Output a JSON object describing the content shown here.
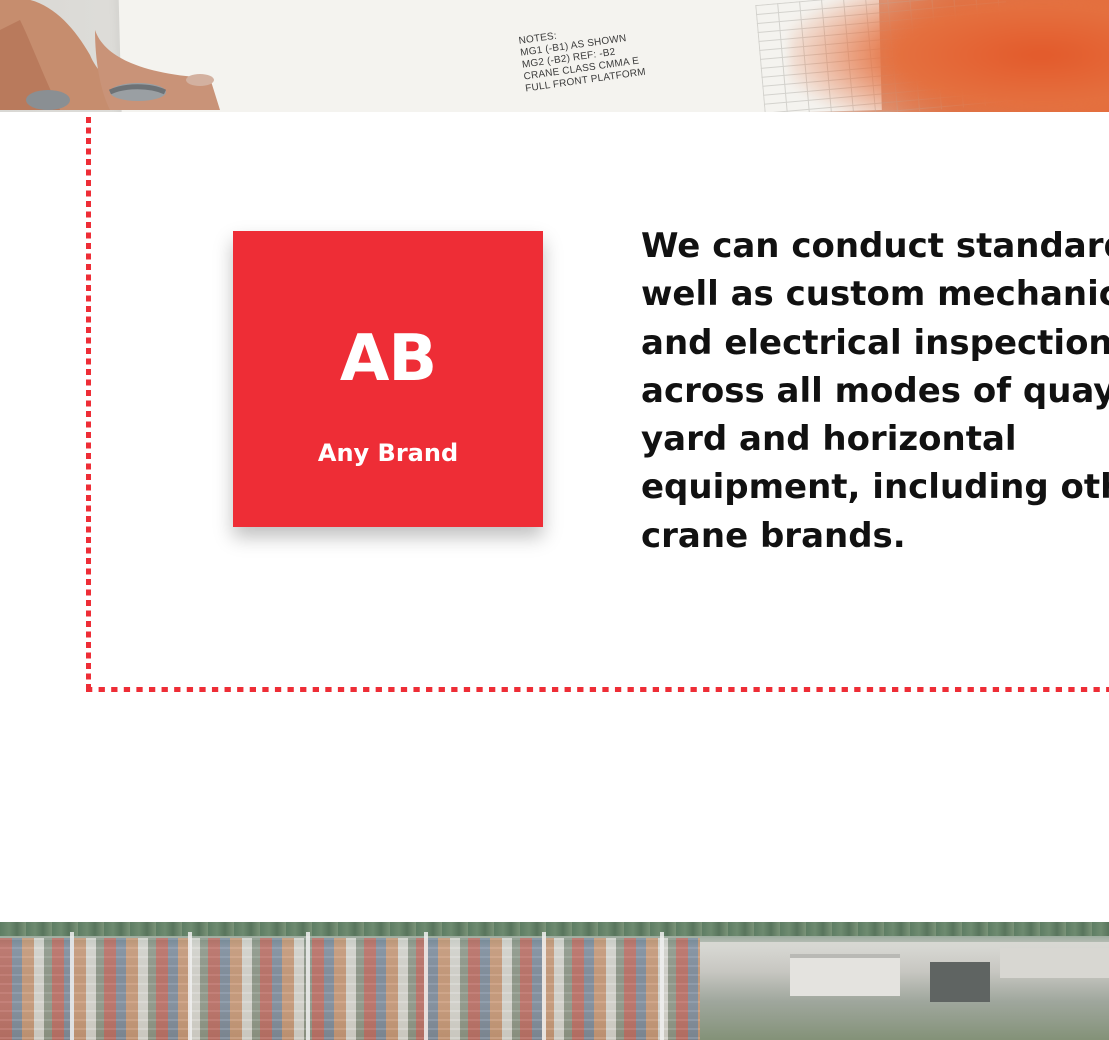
{
  "hero_image": {
    "notes_lines": [
      "NOTES:",
      "MG1 (-B1) AS SHOWN",
      "MG2 (-B2) REF: -B2",
      "CRANE CLASS CMMA E",
      "FULL FRONT PLATFORM"
    ]
  },
  "brand_card": {
    "abbreviation": "AB",
    "name": "Any Brand",
    "background_color": "#ee2d36"
  },
  "description": {
    "lines": [
      "We can conduct standard as",
      "well as custom mechanical",
      "and electrical inspections",
      "across all modes of quay,",
      "yard and horizontal",
      "equipment, including other",
      "crane brands."
    ]
  },
  "accent_color": "#ee2d36"
}
